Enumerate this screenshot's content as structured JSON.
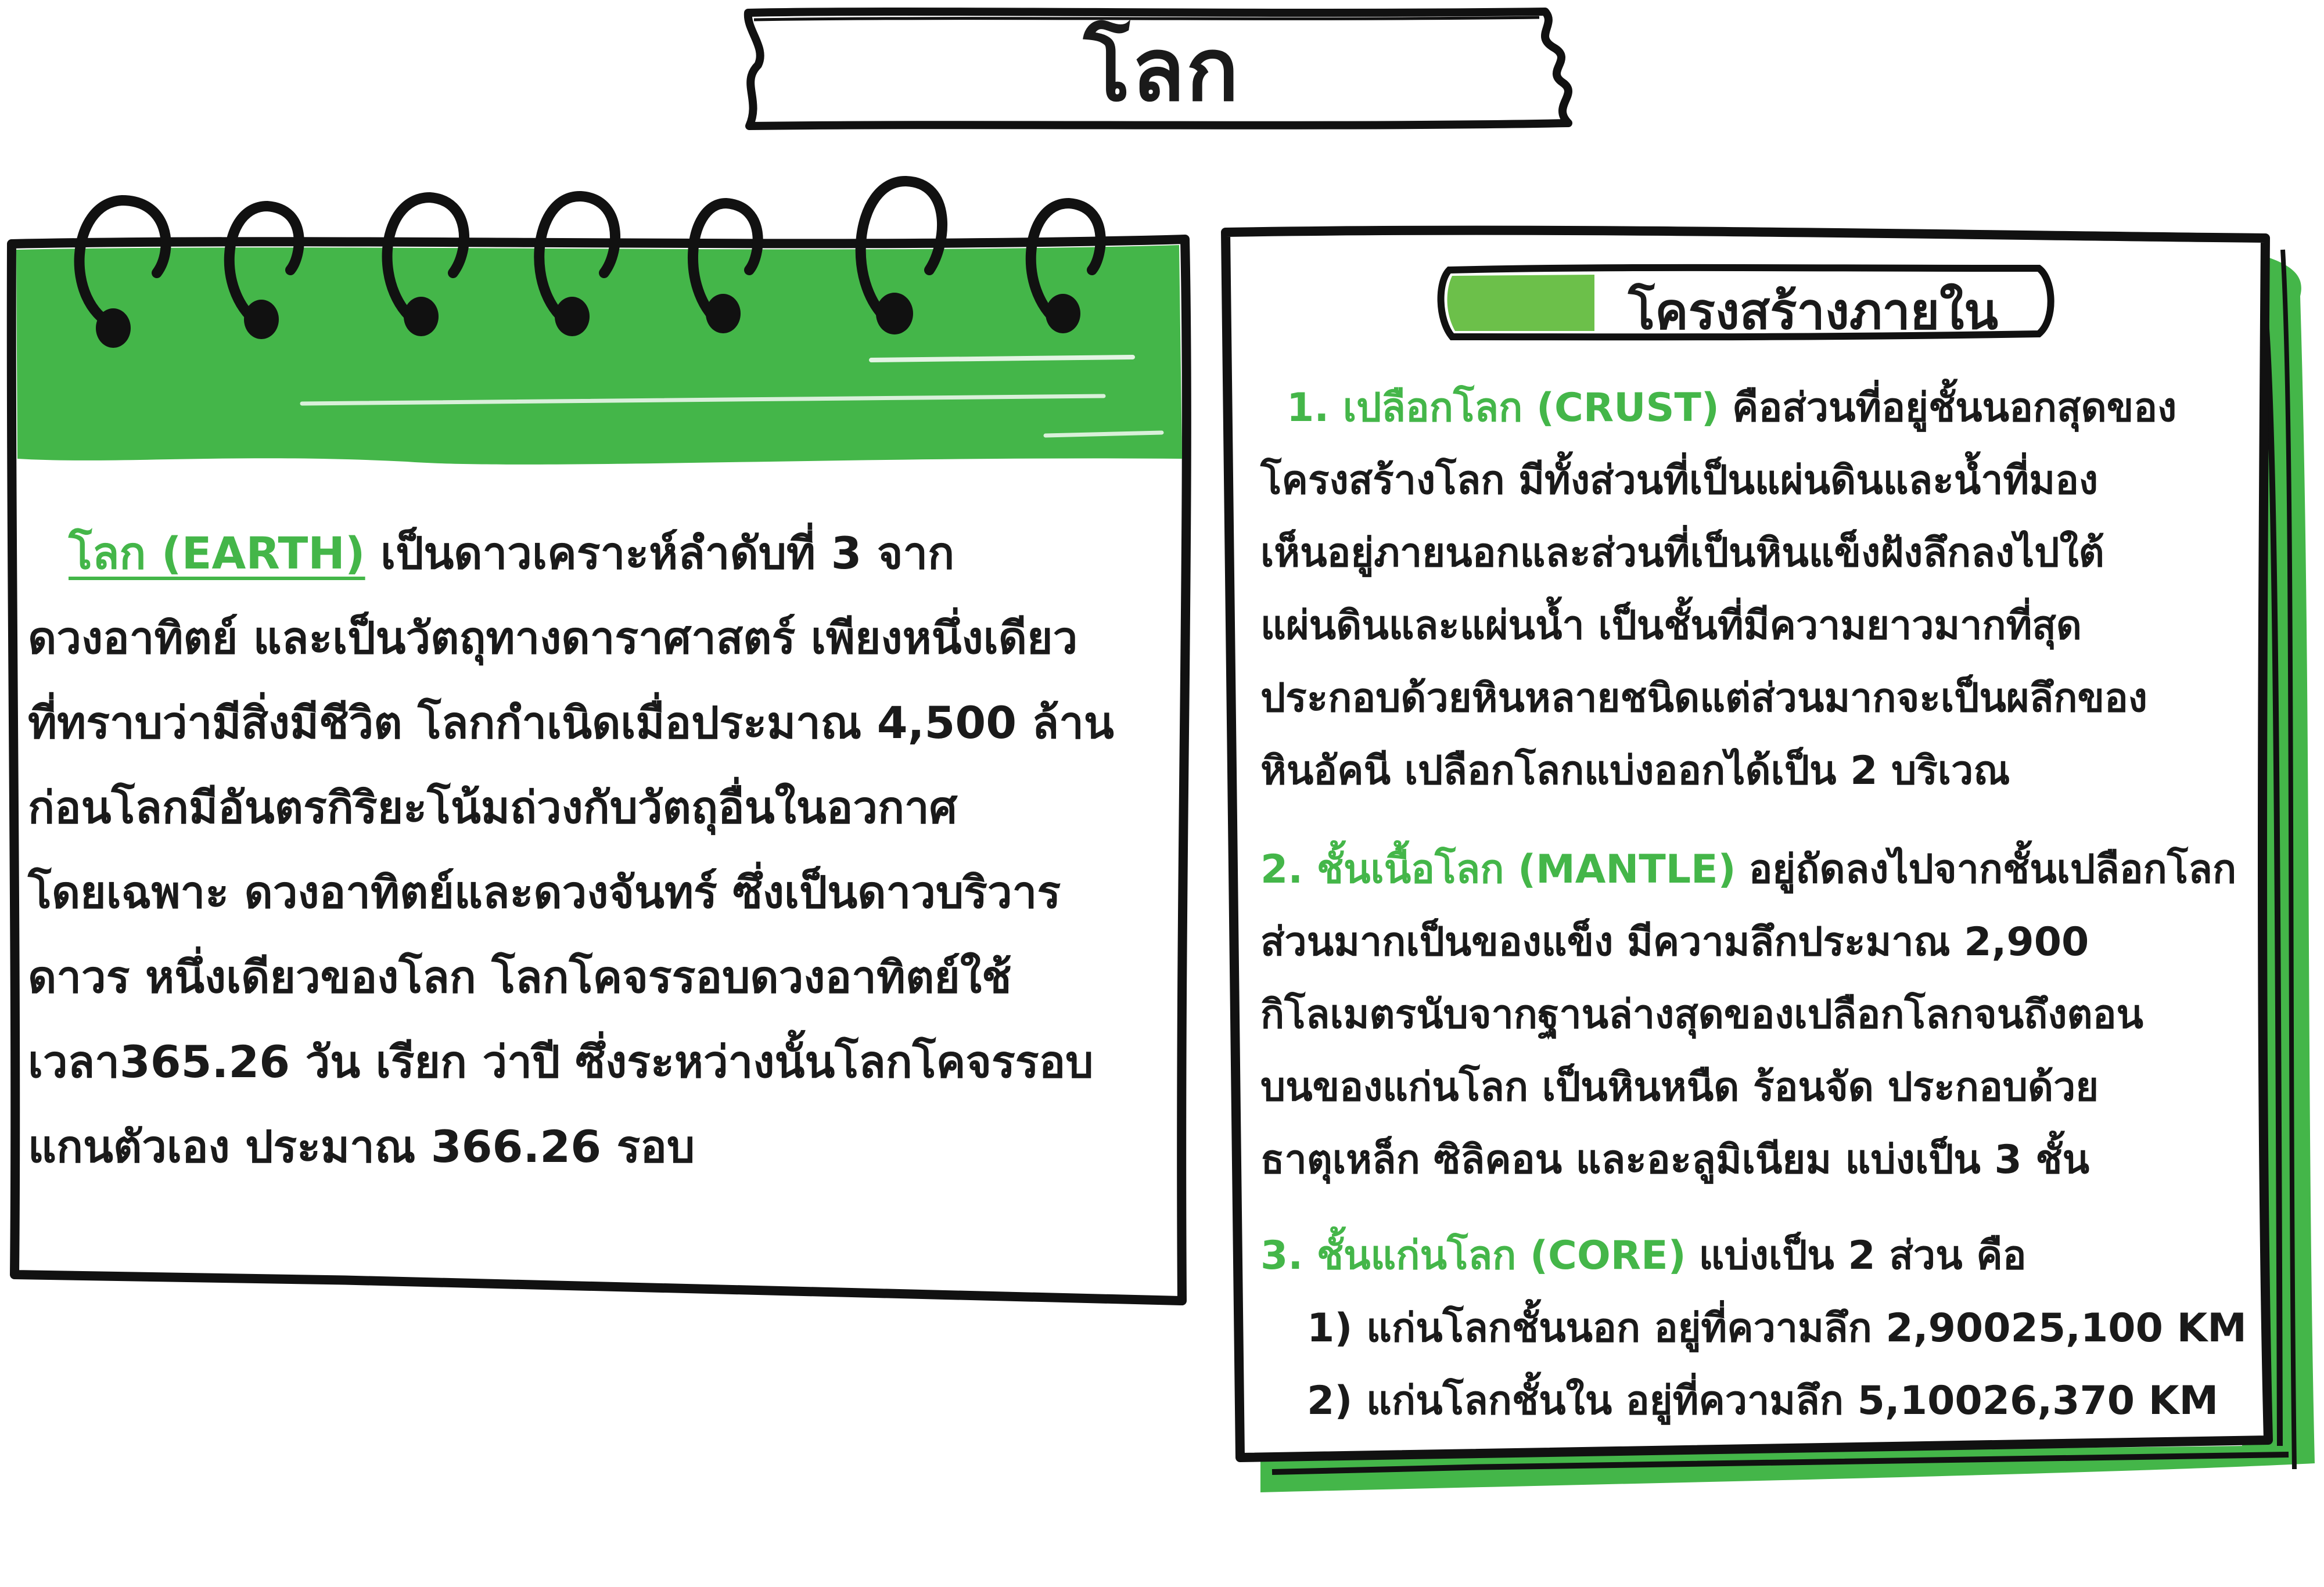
{
  "page": {
    "title": "โลก"
  },
  "colors": {
    "accent_green": "#44b649",
    "ink": "#1a1a1a"
  },
  "left_card": {
    "highlight": "โลก (EARTH)",
    "lines": [
      "เป็นดาวเคราะห์ลำดับที่   3  จาก",
      "ดวงอาทิตย์ และเป็นวัตถุทางดาราศาสตร์ เพียงหนึ่งเดียว",
      "ที่ทราบว่ามีสิ่งมีชีวิต โลกกำเนิดเมื่อประมาณ 4,500 ล้าน",
      "ก่อนโลกมีอันตรกิริยะโน้มถ่วงกับวัตถุอื่นในอวกาศ",
      "โดยเฉพาะ ดวงอาทิตย์และดวงจันทร์ ซึ่งเป็นดาวบริวาร",
      "ดาวร หนึ่งเดียวของโลก โลกโคจรรอบดวงอาทิตย์ใช้",
      "เวลา365.26  วัน เรียก ว่าปี ซึ่งระหว่างนั้นโลกโคจรรอบ",
      "แกนตัวเอง ประมาณ  366.26 รอบ"
    ]
  },
  "right_card": {
    "section_title": "โครงสร้างภายใน",
    "crust": {
      "heading": "1. เปลือกโลก (CRUST)",
      "first_line_rest": "คือส่วนที่อยู่ชั้นนอกสุดของ",
      "lines": [
        "โครงสร้างโลก มีทั้งส่วนที่เป็นแผ่นดินและน้ำที่มอง",
        "เห็นอยู่ภายนอกและส่วนที่เป็นหินแข็งฝังลึกลงไปใต้",
        "แผ่นดินและแผ่นน้ำ เป็นชั้นที่มีความยาวมากที่สุด",
        "ประกอบด้วยหินหลายชนิดแต่ส่วนมากจะเป็นผลึกของ",
        "หินอัคนี เปลือกโลกแบ่งออกได้เป็น 2 บริเวณ"
      ]
    },
    "mantle": {
      "heading": "2. ชั้นเนื้อโลก (MANTLE)",
      "first_line_rest": "อยู่ถัดลงไปจากชั้นเปลือกโลก",
      "lines": [
        "ส่วนมากเป็นของแข็ง มีความลึกประมาณ 2,900",
        "กิโลเมตรนับจากฐานล่างสุดของเปลือกโลกจนถึงตอน",
        "บนของแก่นโลก เป็นหินหนืด ร้อนจัด ประกอบด้วย",
        "ธาตุเหล็ก ซิลิคอน และอะลูมิเนียม แบ่งเป็น 3 ชั้น"
      ]
    },
    "core": {
      "heading": "3. ชั้นแก่นโลก (CORE)",
      "first_line_rest": "แบ่งเป็น 2 ส่วน คือ",
      "lines": [
        "1) แก่นโลกชั้นนอก อยู่ที่ความลึก 2,90025,100 KM",
        "2) แก่นโลกชั้นใน อยู่ที่ความลึก 5,10026,370 KM"
      ]
    }
  }
}
